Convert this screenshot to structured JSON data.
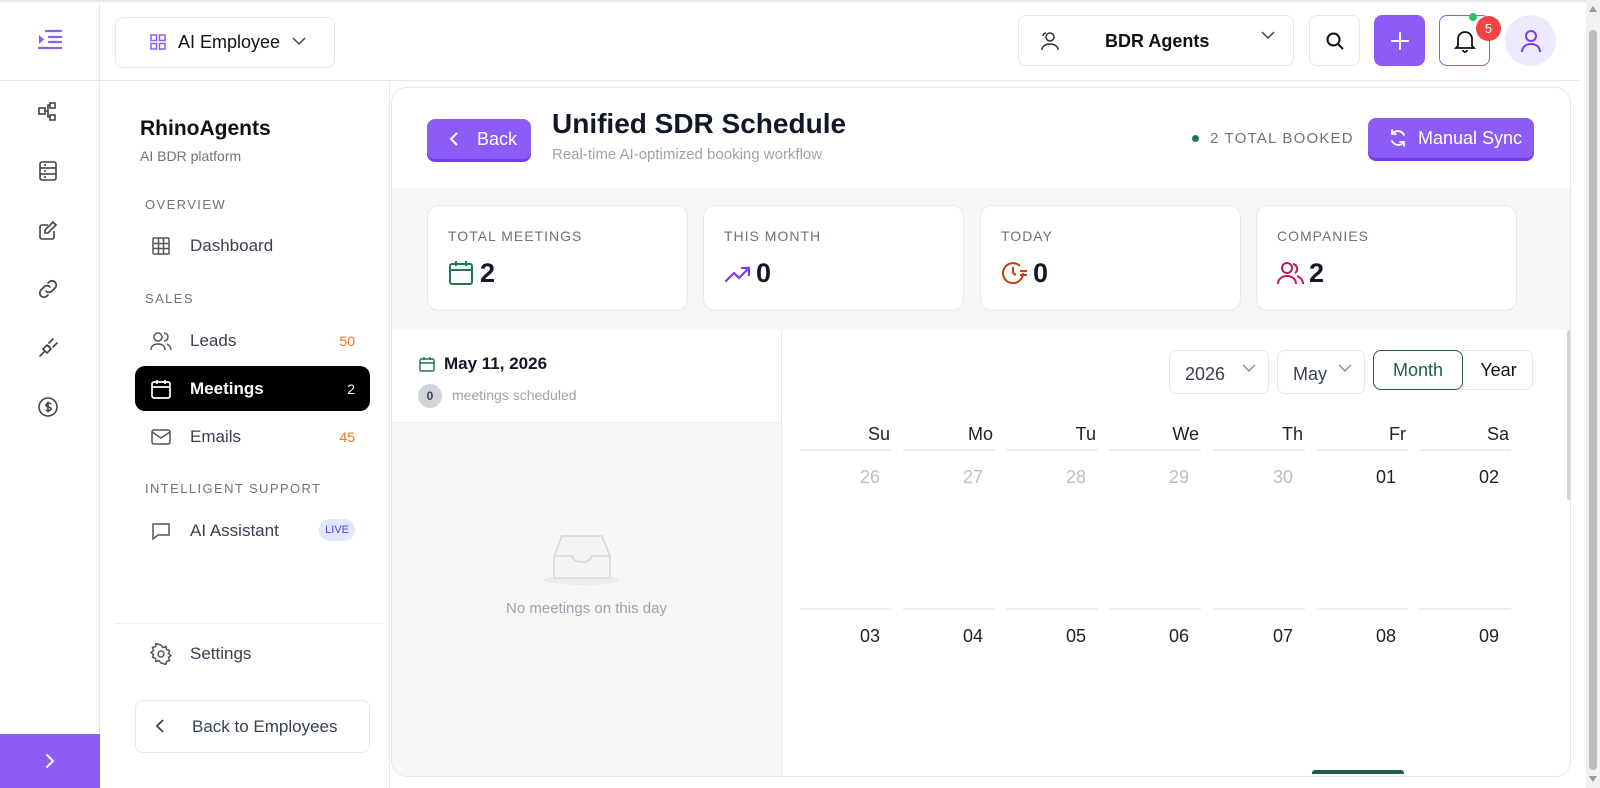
{
  "header": {
    "employee_select": "AI Employee",
    "agent_select": "BDR Agents",
    "notification_count": "5"
  },
  "sidebar": {
    "brand": "RhinoAgents",
    "brand_sub": "AI BDR platform",
    "sections": {
      "overview": "OVERVIEW",
      "sales": "SALES",
      "support": "INTELLIGENT SUPPORT"
    },
    "items": [
      {
        "label": "Dashboard",
        "icon": "grid-icon"
      },
      {
        "label": "Leads",
        "count": "50",
        "icon": "users-icon"
      },
      {
        "label": "Meetings",
        "count": "2",
        "icon": "calendar-icon",
        "active": true
      },
      {
        "label": "Emails",
        "count": "45",
        "icon": "mail-icon"
      },
      {
        "label": "AI Assistant",
        "badge": "LIVE",
        "icon": "chat-icon"
      }
    ],
    "settings": "Settings",
    "back_to_employees": "Back to Employees"
  },
  "page": {
    "back": "Back",
    "title": "Unified SDR Schedule",
    "subtitle": "Real-time AI-optimized booking workflow",
    "total_booked": "2 TOTAL BOOKED",
    "sync": "Manual Sync"
  },
  "stats": [
    {
      "label": "TOTAL MEETINGS",
      "value": "2",
      "icon": "calendar-icon",
      "color": "#1f7a4b"
    },
    {
      "label": "THIS MONTH",
      "value": "0",
      "icon": "trending-up-icon",
      "color": "#7c3aed"
    },
    {
      "label": "TODAY",
      "value": "0",
      "icon": "clock-icon",
      "color": "#c2410c"
    },
    {
      "label": "COMPANIES",
      "value": "2",
      "icon": "users-icon",
      "color": "#be185d"
    }
  ],
  "day": {
    "date": "May 11, 2026",
    "count": "0",
    "count_label": "meetings scheduled",
    "empty": "No meetings on this day"
  },
  "calendar": {
    "year": "2026",
    "month": "May",
    "view_month": "Month",
    "view_year": "Year",
    "weekdays": [
      "Su",
      "Mo",
      "Tu",
      "We",
      "Th",
      "Fr",
      "Sa"
    ],
    "week1": [
      "26",
      "27",
      "28",
      "29",
      "30",
      "01",
      "02"
    ],
    "week2": [
      "03",
      "04",
      "05",
      "06",
      "07",
      "08",
      "09"
    ]
  },
  "colors": {
    "accent": "#8b5cf6",
    "green": "#1f5e46"
  }
}
